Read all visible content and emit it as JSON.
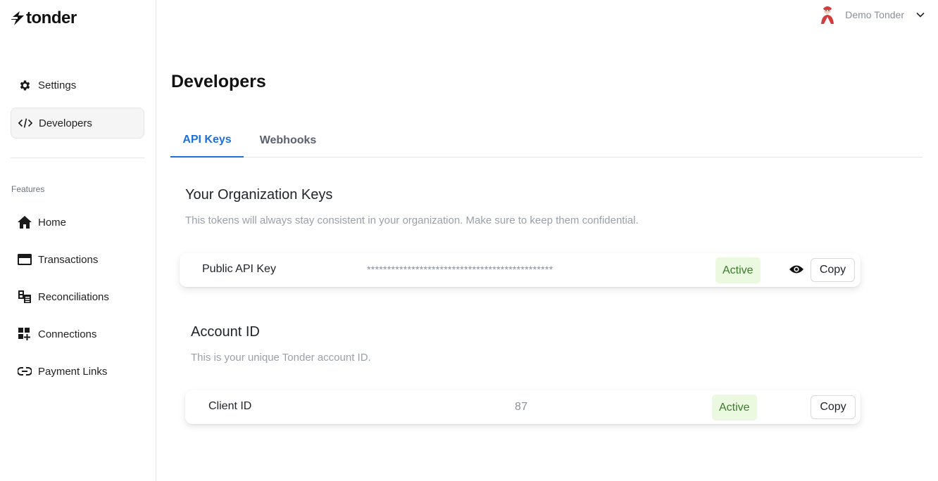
{
  "brand": {
    "name": "tonder"
  },
  "user": {
    "name": "Demo Tonder"
  },
  "sidebar": {
    "top_items": [
      {
        "label": "Settings",
        "icon": "gear-icon"
      },
      {
        "label": "Developers",
        "icon": "code-icon",
        "active": true
      }
    ],
    "section_label": "Features",
    "items": [
      {
        "label": "Home",
        "icon": "home-icon"
      },
      {
        "label": "Transactions",
        "icon": "card-icon"
      },
      {
        "label": "Reconciliations",
        "icon": "reconcile-icon"
      },
      {
        "label": "Connections",
        "icon": "connections-icon"
      },
      {
        "label": "Payment Links",
        "icon": "link-icon"
      }
    ]
  },
  "main": {
    "title": "Developers",
    "tabs": [
      {
        "label": "API Keys",
        "active": true
      },
      {
        "label": "Webhooks",
        "active": false
      }
    ],
    "org_keys": {
      "title": "Your Organization Keys",
      "description": "This tokens will always stay consistent in your organization. Make sure to keep them confidential.",
      "key_name": "Public API Key",
      "key_value": "**********************************************",
      "status": "Active",
      "copy_label": "Copy"
    },
    "account": {
      "title": "Account ID",
      "description": "This is your unique Tonder account ID.",
      "key_name": "Client ID",
      "key_value": "87",
      "status": "Active",
      "copy_label": "Copy"
    }
  },
  "colors": {
    "accent": "#1f6fd8",
    "badge_bg": "#eaf9e0",
    "badge_text": "#3b7a2a"
  }
}
